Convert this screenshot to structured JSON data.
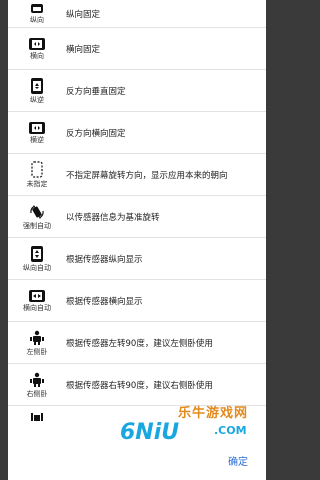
{
  "options": [
    {
      "icon": "portrait-icon",
      "label": "纵向",
      "desc": "纵向固定"
    },
    {
      "icon": "landscape-icon",
      "label": "横向",
      "desc": "横向固定"
    },
    {
      "icon": "reverse-portrait-icon",
      "label": "纵逆",
      "desc": "反方向垂直固定"
    },
    {
      "icon": "reverse-landscape-icon",
      "label": "横逆",
      "desc": "反方向横向固定"
    },
    {
      "icon": "unspecified-icon",
      "label": "未指定",
      "desc": "不指定屏幕旋转方向，显示应用本来的朝向"
    },
    {
      "icon": "auto-rotate-icon",
      "label": "强制自动",
      "desc": "以传感器信息为基准旋转"
    },
    {
      "icon": "auto-portrait-icon",
      "label": "纵向自动",
      "desc": "根据传感器纵向显示"
    },
    {
      "icon": "auto-landscape-icon",
      "label": "横向自动",
      "desc": "根据传感器横向显示"
    },
    {
      "icon": "lie-left-icon",
      "label": "左侧卧",
      "desc": "根据传感器左转90度，建议左侧卧使用"
    },
    {
      "icon": "lie-right-icon",
      "label": "右侧卧",
      "desc": "根据传感器右转90度，建议右侧卧使用"
    }
  ],
  "footer": {
    "confirm_label": "确定"
  },
  "watermark": {
    "brand_text": "乐牛游戏网",
    "logo_text": "6NiU",
    "domain_text": ".COM"
  },
  "colors": {
    "accent": "#2a6fd6",
    "icon": "#111111",
    "divider": "#e2e2e2",
    "backdrop": "#3a3a3a"
  }
}
